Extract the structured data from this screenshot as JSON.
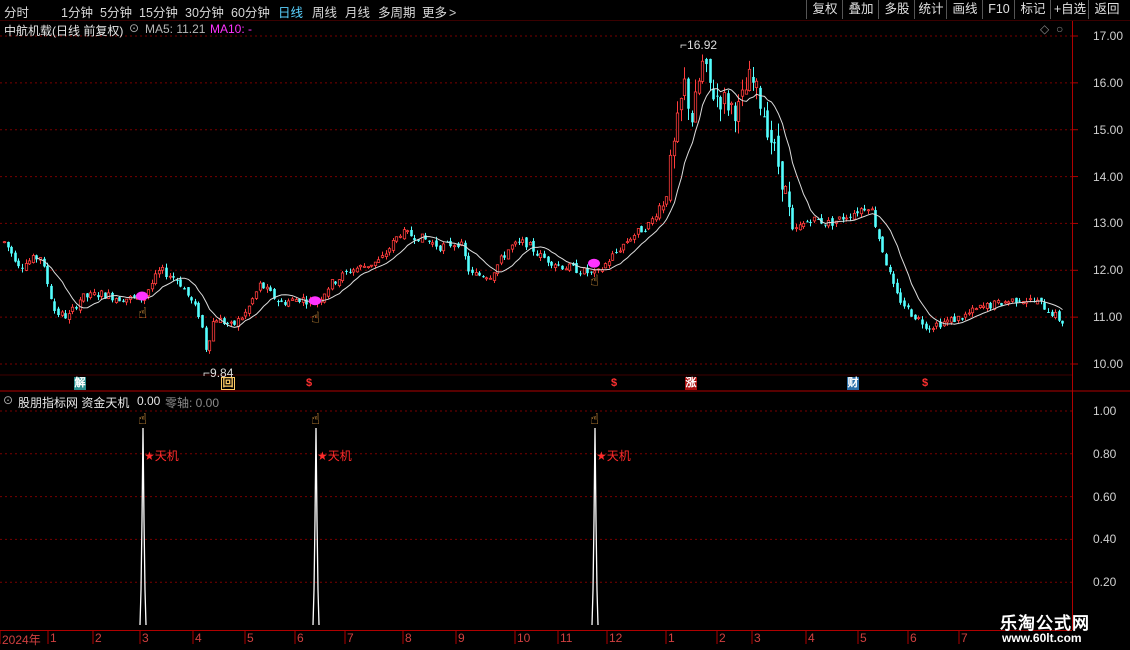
{
  "toolbar": {
    "periods": [
      "分时",
      "1分钟",
      "5分钟",
      "15分钟",
      "30分钟",
      "60分钟",
      "日线",
      "周线",
      "月线",
      "多周期",
      "更多"
    ],
    "active_period": "日线",
    "right_buttons": [
      "复权",
      "叠加",
      "多股",
      "统计",
      "画线",
      "F10",
      "标记",
      "+自选",
      "返回"
    ]
  },
  "main_panel": {
    "stock_title": "中航机载(日线 前复权)",
    "ma5_label": "MA5: 11.21",
    "ma10_label": "MA10: -",
    "high_label": "16.92",
    "low_label": "9.84",
    "y_ticks": [
      "17.00",
      "16.00",
      "15.00",
      "14.00",
      "13.00",
      "12.00",
      "11.00",
      "10.00"
    ],
    "event_markers": [
      {
        "text": "解",
        "color": "#2a8f8f",
        "fg": "#ffffff"
      },
      {
        "text": "回",
        "color": "#000000",
        "fg": "#ffcc66"
      },
      {
        "text": "$",
        "color": "#000000",
        "fg": "#ff3030"
      },
      {
        "text": "$",
        "color": "#000000",
        "fg": "#ff3030"
      },
      {
        "text": "涨",
        "color": "#aa1010",
        "fg": "#ffffff"
      },
      {
        "text": "财",
        "color": "#2a6fa8",
        "fg": "#ffffff"
      },
      {
        "text": "$",
        "color": "#000000",
        "fg": "#ff3030"
      }
    ]
  },
  "indicator_panel": {
    "title": "股朋指标网 资金天机",
    "value": "0.00",
    "zero_axis_label": "零轴: 0.00",
    "signal_label": "★天机",
    "y_ticks": [
      "1.00",
      "0.80",
      "0.60",
      "0.40",
      "0.20"
    ]
  },
  "time_axis": {
    "labels": [
      "2024年",
      "1",
      "2",
      "3",
      "4",
      "5",
      "6",
      "7",
      "8",
      "9",
      "10",
      "11",
      "12",
      "1",
      "2",
      "3",
      "4",
      "5",
      "6",
      "7"
    ]
  },
  "watermark": {
    "line1": "乐淘公式网",
    "line2": "www.60lt.com"
  },
  "colors": {
    "up": "#ff3c3c",
    "down": "#54ffff",
    "ma5": "#e0e0e0",
    "ma10": "#ff33ff",
    "signal_dot": "#ff33ff",
    "axis": "#b00000",
    "grid": "#7a0000"
  },
  "icons": [
    "circle-chevron-down-icon",
    "chevron-right-icon",
    "diamond-icon",
    "pointing-hand-icon",
    "star-icon"
  ]
}
